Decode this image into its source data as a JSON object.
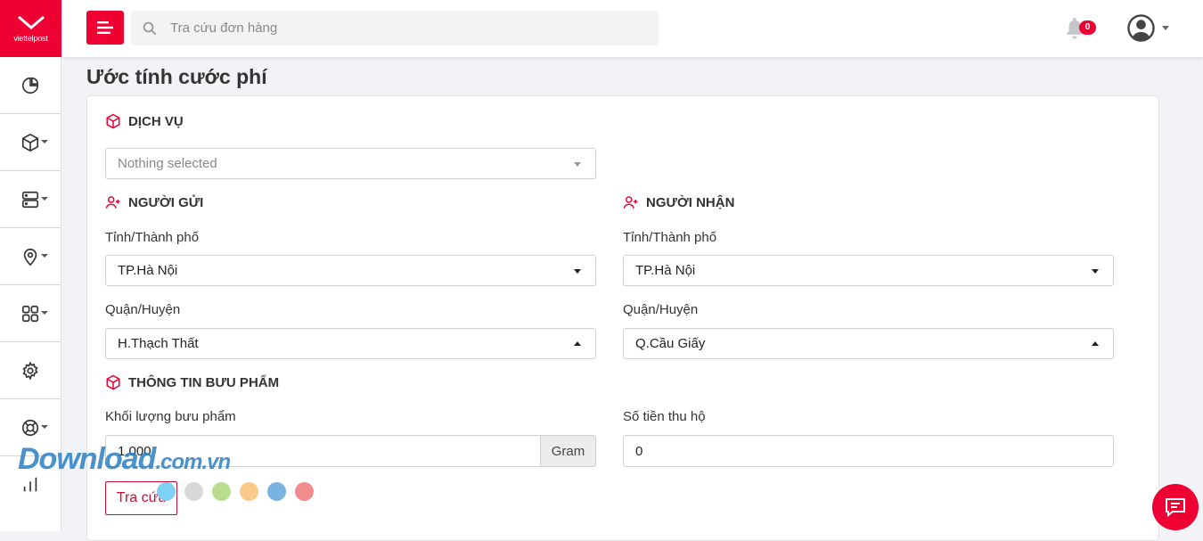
{
  "brand": {
    "mark": "✔",
    "name": "viettelpost",
    "accent": "#ee0033"
  },
  "sidebar": {
    "items": [
      {
        "icon": "pie-chart-icon",
        "has_caret": false
      },
      {
        "icon": "box-icon",
        "has_caret": true
      },
      {
        "icon": "server-icon",
        "has_caret": true
      },
      {
        "icon": "map-pin-icon",
        "has_caret": true
      },
      {
        "icon": "grid-icon",
        "has_caret": true
      },
      {
        "icon": "gear-icon",
        "has_caret": false
      },
      {
        "icon": "lifebuoy-icon",
        "has_caret": true
      },
      {
        "icon": "bar-chart-icon",
        "has_caret": false
      }
    ]
  },
  "topbar": {
    "search_placeholder": "Tra cứu đơn hàng",
    "notification_count": "0"
  },
  "page": {
    "title": "Ước tính cước phí"
  },
  "service": {
    "heading": "DỊCH VỤ",
    "select_value": "Nothing selected"
  },
  "sender": {
    "heading": "NGƯỜI GỬI",
    "province_label": "Tỉnh/Thành phố",
    "province_value": "TP.Hà Nội",
    "district_label": "Quận/Huyện",
    "district_value": "H.Thạch Thất"
  },
  "receiver": {
    "heading": "NGƯỜI NHẬN",
    "province_label": "Tỉnh/Thành phố",
    "province_value": "TP.Hà Nội",
    "district_label": "Quận/Huyện",
    "district_value": "Q.Cầu Giấy"
  },
  "package": {
    "heading": "THÔNG TIN BƯU PHẨM",
    "weight_label": "Khối lượng bưu phẩm",
    "weight_value": "1.000",
    "weight_unit": "Gram",
    "cod_label": "Số tiền thu hộ",
    "cod_value": "0"
  },
  "actions": {
    "lookup_label": "Tra cứu"
  },
  "watermark": {
    "main": "Download",
    "suffix": ".com.vn"
  },
  "dots": [
    "#7fd0f5",
    "#d8d8d8",
    "#b9dd8f",
    "#fbc98a",
    "#79b3e0",
    "#f28b8b"
  ]
}
